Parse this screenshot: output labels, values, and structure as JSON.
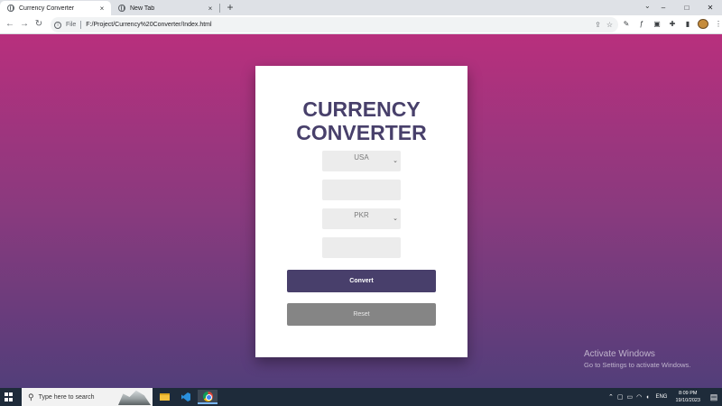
{
  "browser": {
    "tabs": [
      {
        "label": "Currency Converter",
        "close": "×"
      },
      {
        "label": "New Tab",
        "close": "×"
      }
    ],
    "new_tab": "+",
    "window_controls": {
      "dropdown": "⌄",
      "minimize": "–",
      "maximize": "□",
      "close": "✕"
    },
    "nav": {
      "back": "←",
      "forward": "→",
      "reload": "↻"
    },
    "address": {
      "scheme_label": "File",
      "url": "F:/Project/Currency%20Converter/Index.html"
    }
  },
  "converter": {
    "title_line1": "CURRENCY",
    "title_line2": "CONVERTER",
    "from_currency": "USA",
    "from_amount": "",
    "to_currency": "PKR",
    "to_amount": "",
    "convert_label": "Convert",
    "reset_label": "Reset"
  },
  "watermark": {
    "title": "Activate Windows",
    "subtitle": "Go to Settings to activate Windows."
  },
  "taskbar": {
    "search_placeholder": "Type here to search",
    "language": "ENG",
    "time": "8:09 PM",
    "date": "19/10/2023"
  },
  "colors": {
    "card_title": "#48406b",
    "convert_button": "#483f6b",
    "reset_button": "#858585",
    "gradient_top": "#b82f7d",
    "gradient_bottom": "#523e7a"
  },
  "icons": [
    "globe-icon",
    "close-icon",
    "plus-icon",
    "chevron-down-icon",
    "back-icon",
    "forward-icon",
    "reload-icon",
    "info-icon",
    "share-icon",
    "star-icon",
    "extension-icon",
    "windows-start-icon",
    "search-icon",
    "file-explorer-icon",
    "vscode-icon",
    "chrome-icon",
    "notification-icon"
  ]
}
